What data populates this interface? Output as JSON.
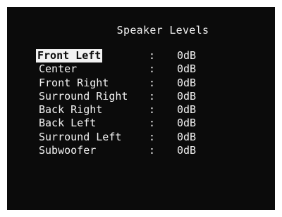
{
  "menu": {
    "title": "Speaker Levels",
    "separator": ":",
    "items": [
      {
        "label": "Front Left",
        "value": "0dB",
        "selected": true
      },
      {
        "label": "Center",
        "value": "0dB",
        "selected": false
      },
      {
        "label": "Front Right",
        "value": "0dB",
        "selected": false
      },
      {
        "label": "Surround Right",
        "value": "0dB",
        "selected": false
      },
      {
        "label": "Back Right",
        "value": "0dB",
        "selected": false
      },
      {
        "label": "Back Left",
        "value": "0dB",
        "selected": false
      },
      {
        "label": "Surround Left",
        "value": "0dB",
        "selected": false
      },
      {
        "label": "Subwoofer",
        "value": "0dB",
        "selected": false
      }
    ]
  },
  "colors": {
    "background": "#0b0b0b",
    "text": "#f2f2f2",
    "highlight": "#f2f2f2"
  }
}
